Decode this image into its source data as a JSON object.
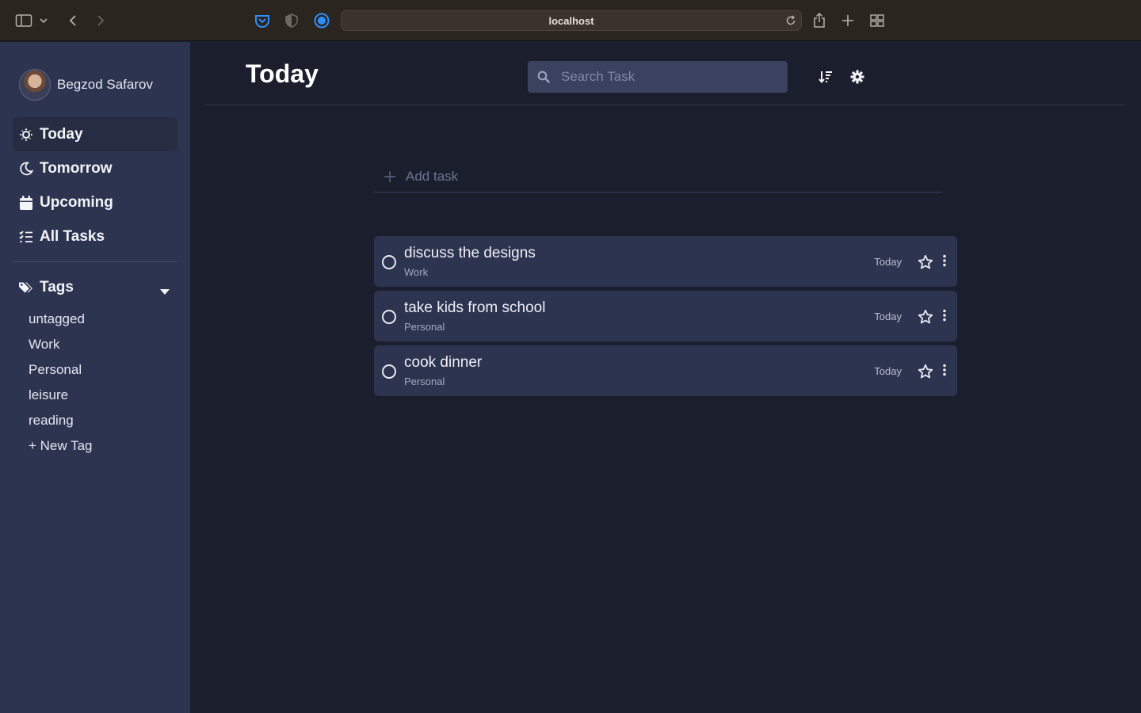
{
  "browser": {
    "url": "localhost",
    "icons": [
      "sidebar-toggle-icon",
      "chevron-down-icon",
      "back-icon",
      "forward-icon",
      "pocket-icon",
      "privacy-shield-icon",
      "extension-icon",
      "reload-icon",
      "share-icon",
      "new-tab-icon",
      "tab-overview-icon"
    ]
  },
  "user": {
    "name": "Begzod Safarov"
  },
  "nav": [
    {
      "label": "Today",
      "icon": "sun-icon",
      "active": true
    },
    {
      "label": "Tomorrow",
      "icon": "moon-icon",
      "active": false
    },
    {
      "label": "Upcoming",
      "icon": "calendar-icon",
      "active": false
    },
    {
      "label": "All Tasks",
      "icon": "task-list-icon",
      "active": false
    }
  ],
  "tags": {
    "heading": "Tags",
    "items": [
      "untagged",
      "Work",
      "Personal",
      "leisure",
      "reading"
    ],
    "new_tag": "+ New Tag"
  },
  "header": {
    "title": "Today",
    "search_placeholder": "Search Task"
  },
  "add_task": {
    "label": "Add task"
  },
  "tasks": [
    {
      "title": "discuss the designs",
      "tag": "Work",
      "date": "Today"
    },
    {
      "title": "take kids from school",
      "tag": "Personal",
      "date": "Today"
    },
    {
      "title": "cook dinner",
      "tag": "Personal",
      "date": "Today"
    }
  ],
  "colors": {
    "sidebar_bg": "#2d3450",
    "main_bg": "#1b1f2d",
    "task_bg": "#2d3450",
    "search_bg": "#3b4260",
    "active_nav_bg": "#262c42",
    "chrome_bg": "#2b2520",
    "accent_blue": "#2f8fff"
  }
}
